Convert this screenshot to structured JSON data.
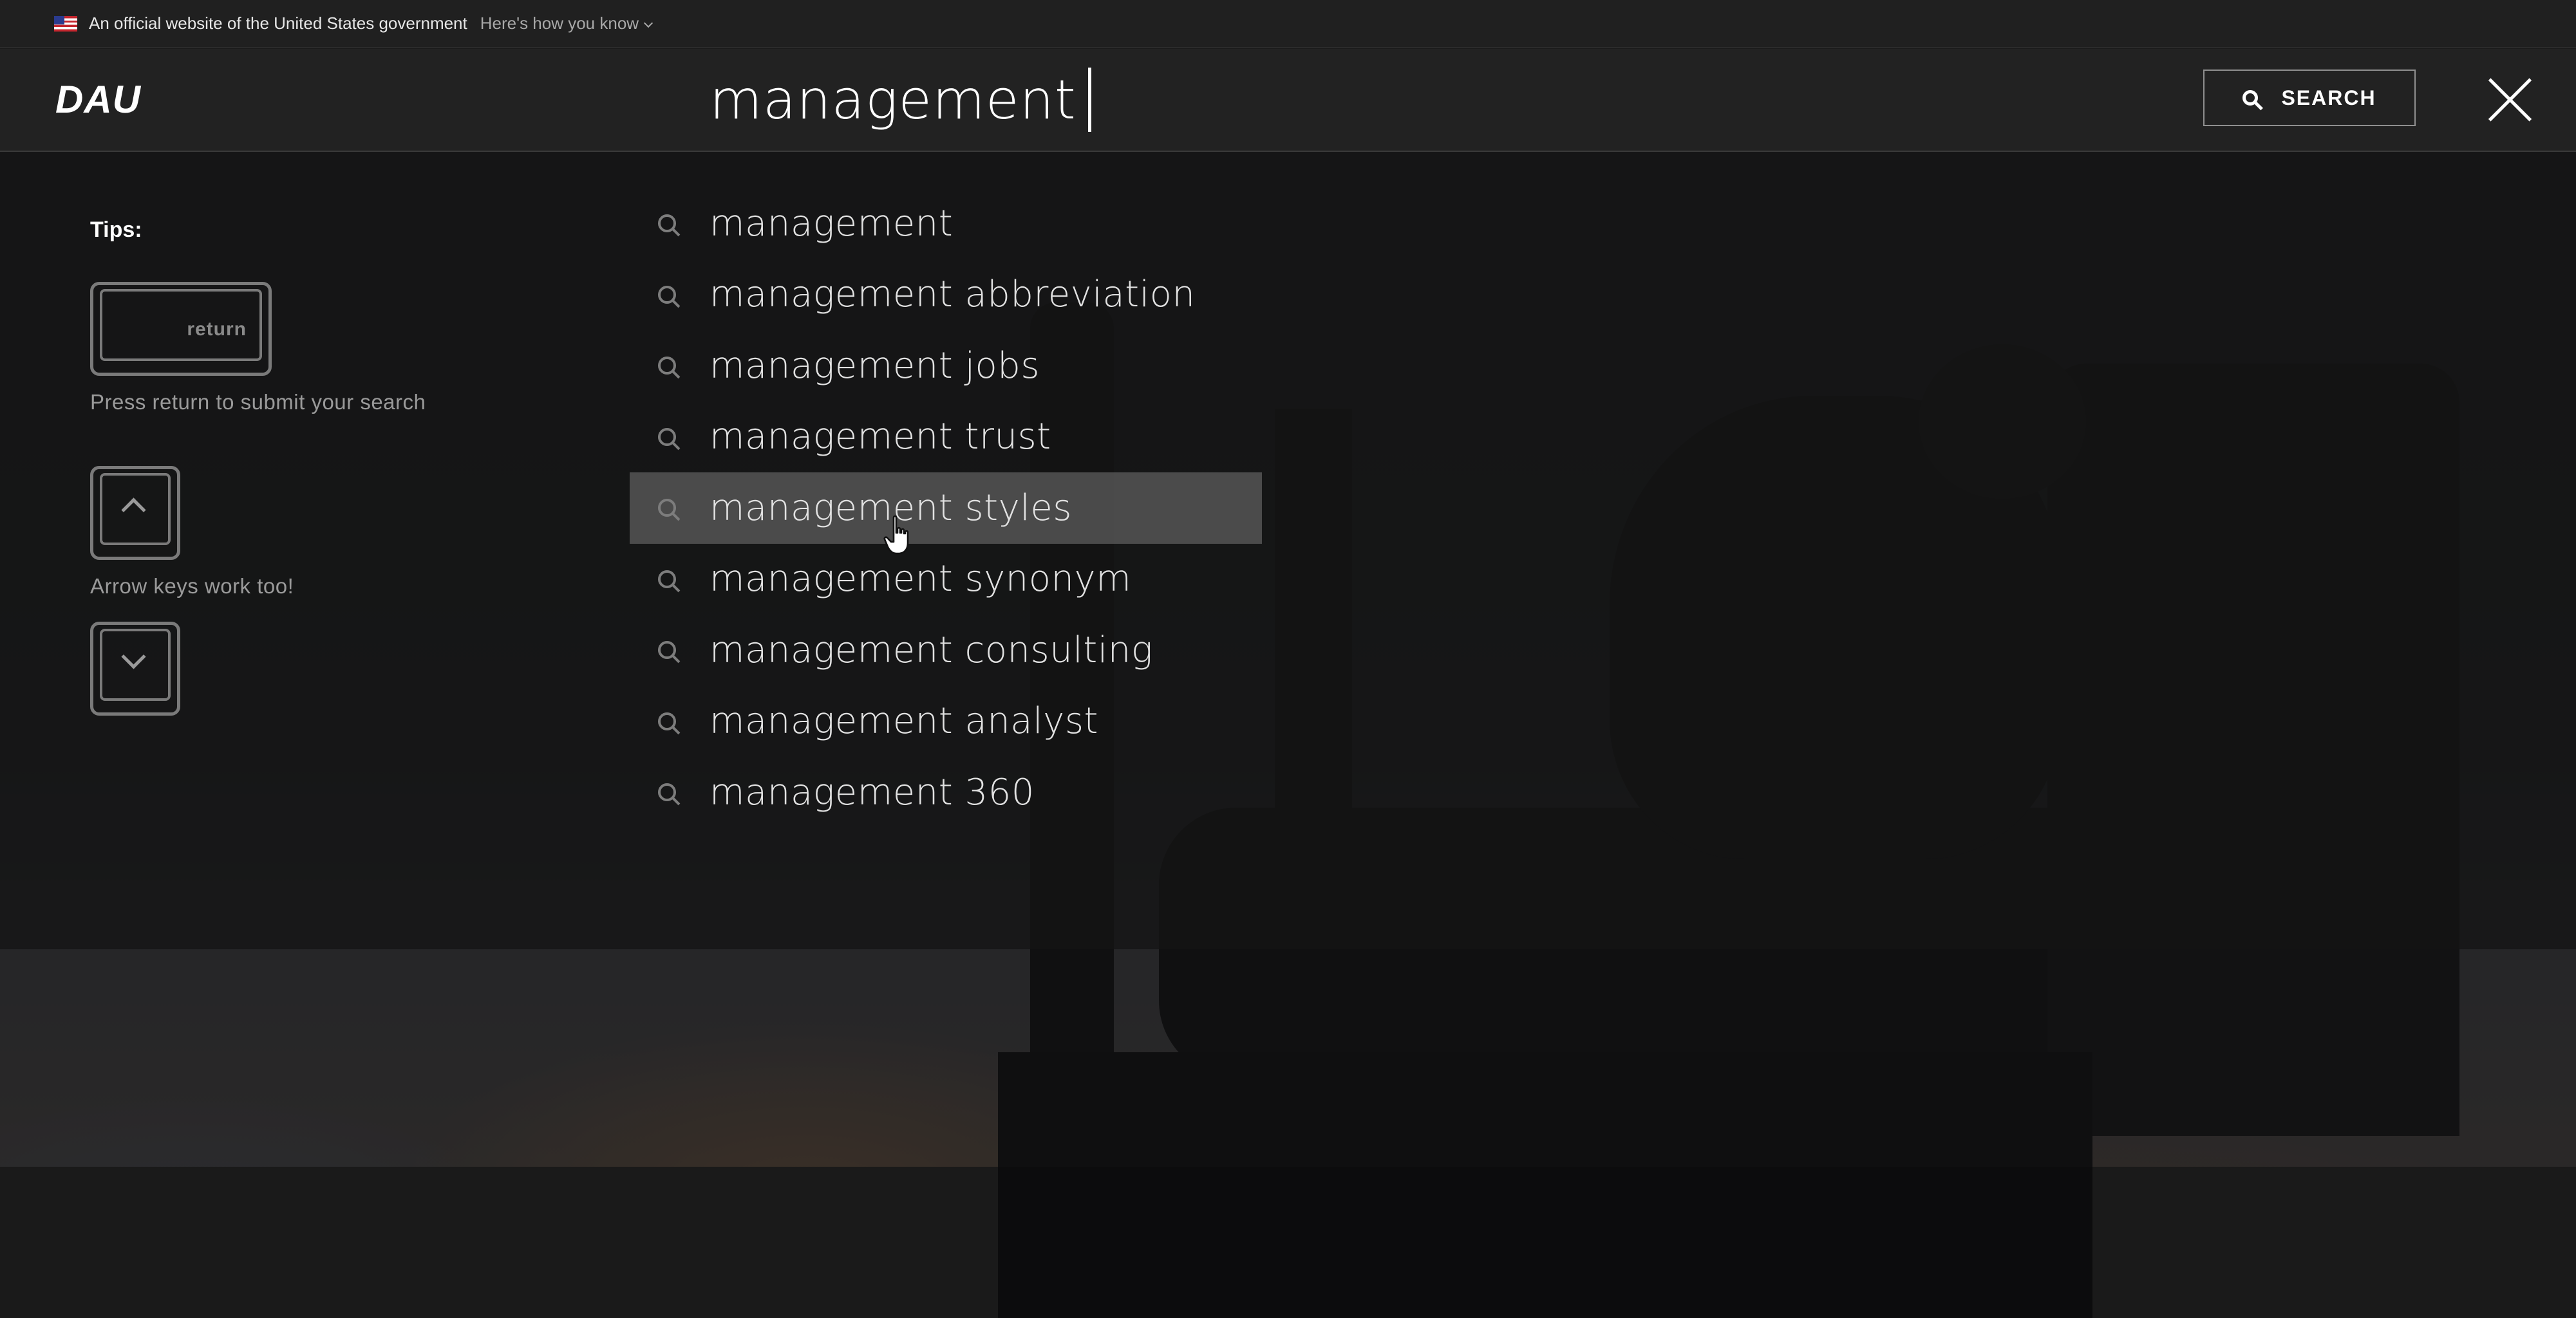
{
  "gov_banner": {
    "text": "An official website of the United States government",
    "link": "Here's how you know"
  },
  "header": {
    "logo": "DAU",
    "search_value": "management",
    "search_button_label": "SEARCH"
  },
  "tips": {
    "title": "Tips:",
    "return_key_label": "return",
    "return_tip": "Press return to submit your search",
    "arrows_tip": "Arrow keys work too!"
  },
  "suggestions": [
    {
      "label": "management"
    },
    {
      "label": "management abbreviation"
    },
    {
      "label": "management jobs"
    },
    {
      "label": "management trust"
    },
    {
      "label": "management styles",
      "active": true
    },
    {
      "label": "management synonym"
    },
    {
      "label": "management consulting"
    },
    {
      "label": "management analyst"
    },
    {
      "label": "management 360"
    }
  ],
  "colors": {
    "background": "#1a1a1a",
    "header": "#222222",
    "highlight": "#787878"
  }
}
